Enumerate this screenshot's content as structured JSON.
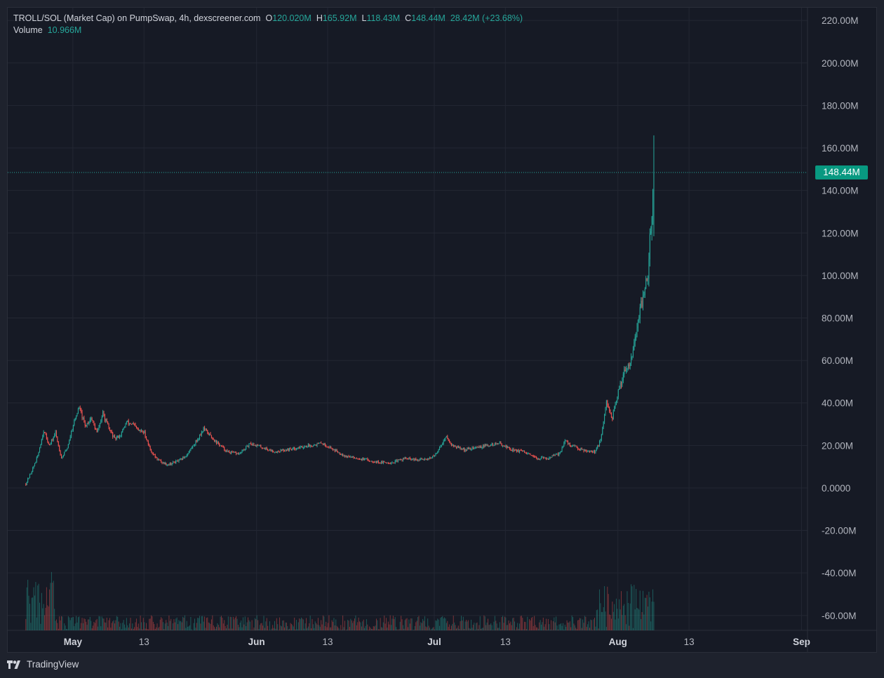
{
  "header": {
    "title": "TROLL/SOL (Market Cap) on PumpSwap, 4h, dexscreener.com",
    "ohlc": [
      {
        "key": "O",
        "value": "120.020M"
      },
      {
        "key": "H",
        "value": "165.92M"
      },
      {
        "key": "L",
        "value": "118.43M"
      },
      {
        "key": "C",
        "value": "148.44M"
      }
    ],
    "change": "28.42M (+23.68%)",
    "volume_label": "Volume",
    "volume_value": "10.966M"
  },
  "price_tag": "148.44M",
  "footer": {
    "brand": "TradingView"
  },
  "colors": {
    "up": "#26a69a",
    "down": "#ef5350",
    "tag": "#089981",
    "background": "#161a25",
    "grid": "#232733"
  },
  "chart_data": {
    "type": "candlestick",
    "timeframe": "4h",
    "y_axis": {
      "ticks": [
        "220.00M",
        "200.00M",
        "180.00M",
        "160.00M",
        "140.00M",
        "120.00M",
        "100.00M",
        "80.00M",
        "60.00M",
        "40.00M",
        "20.00M",
        "0.0000",
        "-20.00M",
        "-40.00M",
        "-60.00M"
      ],
      "tick_values": [
        220,
        200,
        180,
        160,
        140,
        120,
        100,
        80,
        60,
        40,
        20,
        0,
        -20,
        -40,
        -60
      ],
      "unit": "M",
      "range": [
        -67,
        226
      ]
    },
    "x_axis": {
      "range": [
        "2025-04-20",
        "2025-09-02"
      ],
      "ticks": [
        {
          "label": "May",
          "date": "2025-05-01",
          "month": true
        },
        {
          "label": "13",
          "date": "2025-05-13",
          "month": false
        },
        {
          "label": "Jun",
          "date": "2025-06-01",
          "month": true
        },
        {
          "label": "13",
          "date": "2025-06-13",
          "month": false
        },
        {
          "label": "Jul",
          "date": "2025-07-01",
          "month": true
        },
        {
          "label": "13",
          "date": "2025-07-13",
          "month": false
        },
        {
          "label": "Aug",
          "date": "2025-08-01",
          "month": true
        },
        {
          "label": "13",
          "date": "2025-08-13",
          "month": false
        },
        {
          "label": "Sep",
          "date": "2025-09-01",
          "month": true
        }
      ]
    },
    "last_close": 148.44,
    "close_trend": [
      [
        "2025-04-23",
        2
      ],
      [
        "2025-04-24",
        8
      ],
      [
        "2025-04-25",
        15
      ],
      [
        "2025-04-26",
        27
      ],
      [
        "2025-04-27",
        20
      ],
      [
        "2025-04-28",
        26
      ],
      [
        "2025-04-29",
        14
      ],
      [
        "2025-04-30",
        19
      ],
      [
        "2025-05-01",
        30
      ],
      [
        "2025-05-02",
        38
      ],
      [
        "2025-05-03",
        29
      ],
      [
        "2025-05-04",
        33
      ],
      [
        "2025-05-05",
        26
      ],
      [
        "2025-05-06",
        35
      ],
      [
        "2025-05-07",
        28
      ],
      [
        "2025-05-08",
        23
      ],
      [
        "2025-05-09",
        25
      ],
      [
        "2025-05-10",
        31
      ],
      [
        "2025-05-11",
        30
      ],
      [
        "2025-05-12",
        27
      ],
      [
        "2025-05-13",
        26
      ],
      [
        "2025-05-14",
        18
      ],
      [
        "2025-05-15",
        14
      ],
      [
        "2025-05-16",
        12
      ],
      [
        "2025-05-17",
        11
      ],
      [
        "2025-05-18",
        12
      ],
      [
        "2025-05-19",
        13
      ],
      [
        "2025-05-20",
        15
      ],
      [
        "2025-05-22",
        23
      ],
      [
        "2025-05-23",
        28
      ],
      [
        "2025-05-24",
        25
      ],
      [
        "2025-05-25",
        22
      ],
      [
        "2025-05-27",
        17
      ],
      [
        "2025-05-29",
        16
      ],
      [
        "2025-05-31",
        21
      ],
      [
        "2025-06-02",
        19
      ],
      [
        "2025-06-04",
        17
      ],
      [
        "2025-06-06",
        18
      ],
      [
        "2025-06-08",
        19
      ],
      [
        "2025-06-10",
        20
      ],
      [
        "2025-06-12",
        21
      ],
      [
        "2025-06-14",
        18
      ],
      [
        "2025-06-16",
        15
      ],
      [
        "2025-06-18",
        14
      ],
      [
        "2025-06-20",
        13
      ],
      [
        "2025-06-22",
        12
      ],
      [
        "2025-06-24",
        12
      ],
      [
        "2025-06-26",
        14
      ],
      [
        "2025-06-28",
        13
      ],
      [
        "2025-06-30",
        14
      ],
      [
        "2025-07-01",
        15
      ],
      [
        "2025-07-02",
        20
      ],
      [
        "2025-07-03",
        24
      ],
      [
        "2025-07-04",
        20
      ],
      [
        "2025-07-06",
        18
      ],
      [
        "2025-07-08",
        19
      ],
      [
        "2025-07-10",
        20
      ],
      [
        "2025-07-12",
        21
      ],
      [
        "2025-07-14",
        18
      ],
      [
        "2025-07-16",
        17
      ],
      [
        "2025-07-18",
        14
      ],
      [
        "2025-07-20",
        14
      ],
      [
        "2025-07-22",
        16
      ],
      [
        "2025-07-23",
        22
      ],
      [
        "2025-07-24",
        20
      ],
      [
        "2025-07-26",
        18
      ],
      [
        "2025-07-28",
        17
      ],
      [
        "2025-07-29",
        22
      ],
      [
        "2025-07-30",
        40
      ],
      [
        "2025-07-31",
        33
      ],
      [
        "2025-08-01",
        45
      ],
      [
        "2025-08-02",
        55
      ],
      [
        "2025-08-03",
        60
      ],
      [
        "2025-08-04",
        72
      ],
      [
        "2025-08-05",
        88
      ],
      [
        "2025-08-06",
        100
      ],
      [
        "2025-08-07",
        148
      ]
    ]
  }
}
